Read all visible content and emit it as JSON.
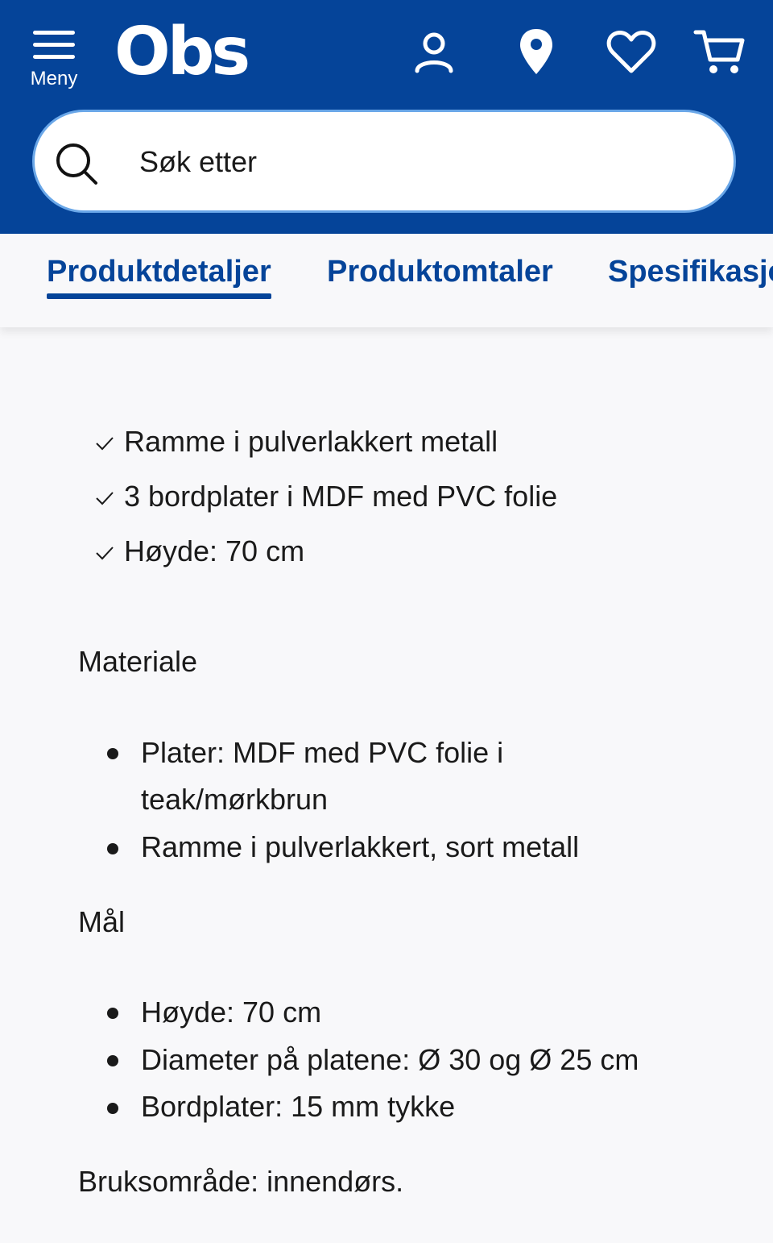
{
  "header": {
    "menu_label": "Meny",
    "logo_text": "Obs",
    "bg_color": "#054499"
  },
  "icons": [
    "menu-icon",
    "user-icon",
    "location-pin-icon",
    "heart-icon",
    "cart-icon",
    "search-icon",
    "check-icon"
  ],
  "search": {
    "placeholder": "Søk etter"
  },
  "tabs": [
    {
      "label": "Produktdetaljer",
      "active": true
    },
    {
      "label": "Produktomtaler",
      "active": false
    },
    {
      "label": "Spesifikasjoner",
      "active": false
    }
  ],
  "content": {
    "features": [
      "Ramme i pulverlakkert metall",
      "3 bordplater i MDF med PVC folie",
      "Høyde: 70 cm"
    ],
    "material_heading": "Materiale",
    "material_items": [
      {
        "line1": "Plater: MDF med PVC folie i",
        "line2": "teak/mørkbrun"
      },
      {
        "line1": "Ramme i pulverlakkert, sort metall"
      }
    ],
    "dimensions_heading": "Mål",
    "dimension_items": [
      "Høyde: 70 cm",
      "Diameter på platene: Ø 30 og Ø 25 cm",
      "Bordplater: 15 mm tykke"
    ],
    "usage": "Bruksområde: innendørs."
  }
}
